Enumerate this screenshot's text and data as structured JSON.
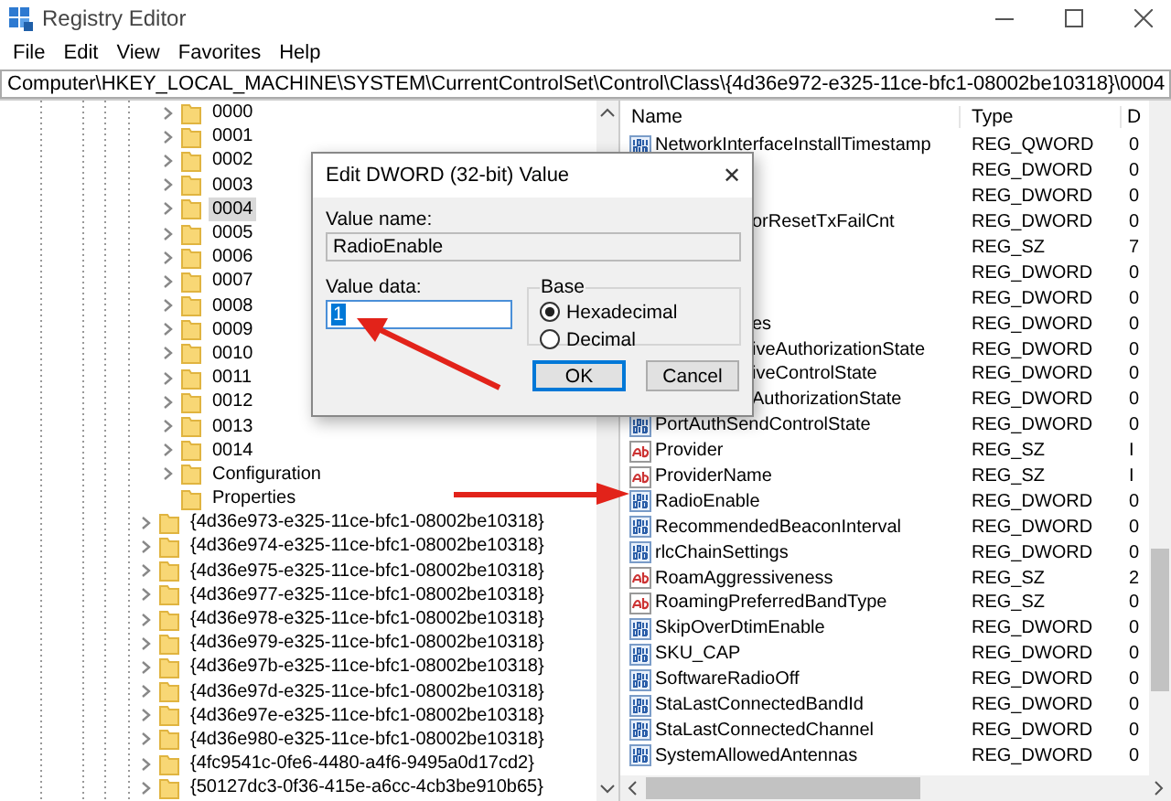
{
  "window": {
    "title": "Registry Editor"
  },
  "menu": [
    "File",
    "Edit",
    "View",
    "Favorites",
    "Help"
  ],
  "address": "Computer\\HKEY_LOCAL_MACHINE\\SYSTEM\\CurrentControlSet\\Control\\Class\\{4d36e972-e325-11ce-bfc1-08002be10318}\\0004",
  "tree": {
    "nodes": [
      {
        "children": [
          {
            "label": "0000",
            "expandable": true,
            "selected": false
          },
          {
            "label": "0001",
            "expandable": true,
            "selected": false
          },
          {
            "label": "0002",
            "expandable": true,
            "selected": false
          },
          {
            "label": "0003",
            "expandable": true,
            "selected": false
          },
          {
            "label": "0004",
            "expandable": true,
            "selected": true
          },
          {
            "label": "0005",
            "expandable": true,
            "selected": false
          },
          {
            "label": "0006",
            "expandable": true,
            "selected": false
          },
          {
            "label": "0007",
            "expandable": true,
            "selected": false
          },
          {
            "label": "0008",
            "expandable": true,
            "selected": false
          },
          {
            "label": "0009",
            "expandable": true,
            "selected": false
          },
          {
            "label": "0010",
            "expandable": true,
            "selected": false
          },
          {
            "label": "0011",
            "expandable": true,
            "selected": false
          },
          {
            "label": "0012",
            "expandable": true,
            "selected": false
          },
          {
            "label": "0013",
            "expandable": true,
            "selected": false
          },
          {
            "label": "0014",
            "expandable": true,
            "selected": false
          },
          {
            "label": "Configuration",
            "expandable": true,
            "selected": false
          },
          {
            "label": "Properties",
            "expandable": false,
            "selected": false
          }
        ]
      },
      {
        "label": "{4d36e973-e325-11ce-bfc1-08002be10318}",
        "expandable": true,
        "selected": false
      },
      {
        "label": "{4d36e974-e325-11ce-bfc1-08002be10318}",
        "expandable": true,
        "selected": false
      },
      {
        "label": "{4d36e975-e325-11ce-bfc1-08002be10318}",
        "expandable": true,
        "selected": false
      },
      {
        "label": "{4d36e977-e325-11ce-bfc1-08002be10318}",
        "expandable": true,
        "selected": false
      },
      {
        "label": "{4d36e978-e325-11ce-bfc1-08002be10318}",
        "expandable": true,
        "selected": false
      },
      {
        "label": "{4d36e979-e325-11ce-bfc1-08002be10318}",
        "expandable": true,
        "selected": false
      },
      {
        "label": "{4d36e97b-e325-11ce-bfc1-08002be10318}",
        "expandable": true,
        "selected": false
      },
      {
        "label": "{4d36e97d-e325-11ce-bfc1-08002be10318}",
        "expandable": true,
        "selected": false
      },
      {
        "label": "{4d36e97e-e325-11ce-bfc1-08002be10318}",
        "expandable": true,
        "selected": false
      },
      {
        "label": "{4d36e980-e325-11ce-bfc1-08002be10318}",
        "expandable": true,
        "selected": false
      },
      {
        "label": "{4fc9541c-0fe6-4480-a4f6-9495a0d17cd2}",
        "expandable": true,
        "selected": false
      },
      {
        "label": "{50127dc3-0f36-415e-a6cc-4cb3be910b65}",
        "expandable": true,
        "selected": false
      }
    ]
  },
  "values": {
    "columns": [
      "Name",
      "Type",
      "D"
    ],
    "rows": [
      {
        "name": "NetworkInterfaceInstallTimestamp",
        "type": "REG_QWORD",
        "data": "0",
        "kind": "number",
        "covered": false
      },
      {
        "type": "REG_DWORD",
        "data": "0"
      },
      {
        "type": "REG_DWORD",
        "data": "0"
      },
      {
        "name": "orResetTxFailCnt",
        "type": "REG_DWORD",
        "data": "0",
        "covered": true
      },
      {
        "type": "REG_SZ",
        "data": "7"
      },
      {
        "type": "REG_DWORD",
        "data": "0"
      },
      {
        "type": "REG_DWORD",
        "data": "0"
      },
      {
        "name": "es",
        "type": "REG_DWORD",
        "data": "0",
        "covered": true
      },
      {
        "name": "iveAuthorizationState",
        "type": "REG_DWORD",
        "data": "0",
        "covered": true
      },
      {
        "name": "iveControlState",
        "type": "REG_DWORD",
        "data": "0",
        "covered": true
      },
      {
        "name": "AuthorizationState",
        "type": "REG_DWORD",
        "data": "0",
        "covered": true
      },
      {
        "name": "PortAuthSendControlState",
        "type": "REG_DWORD",
        "data": "0",
        "kind": "number",
        "covered": false
      },
      {
        "name": "Provider",
        "type": "REG_SZ",
        "data": "I",
        "kind": "string",
        "covered": false
      },
      {
        "name": "ProviderName",
        "type": "REG_SZ",
        "data": "I",
        "kind": "string",
        "covered": false
      },
      {
        "name": "RadioEnable",
        "type": "REG_DWORD",
        "data": "0",
        "kind": "number",
        "covered": false
      },
      {
        "name": "RecommendedBeaconInterval",
        "type": "REG_DWORD",
        "data": "0",
        "kind": "number",
        "covered": false
      },
      {
        "name": "rlcChainSettings",
        "type": "REG_DWORD",
        "data": "0",
        "kind": "number",
        "covered": false
      },
      {
        "name": "RoamAggressiveness",
        "type": "REG_SZ",
        "data": "2",
        "kind": "string",
        "covered": false
      },
      {
        "name": "RoamingPreferredBandType",
        "type": "REG_SZ",
        "data": "0",
        "kind": "string",
        "covered": false
      },
      {
        "name": "SkipOverDtimEnable",
        "type": "REG_DWORD",
        "data": "0",
        "kind": "number",
        "covered": false
      },
      {
        "name": "SKU_CAP",
        "type": "REG_DWORD",
        "data": "0",
        "kind": "number",
        "covered": false
      },
      {
        "name": "SoftwareRadioOff",
        "type": "REG_DWORD",
        "data": "0",
        "kind": "number",
        "covered": false
      },
      {
        "name": "StaLastConnectedBandId",
        "type": "REG_DWORD",
        "data": "0",
        "kind": "number",
        "covered": false
      },
      {
        "name": "StaLastConnectedChannel",
        "type": "REG_DWORD",
        "data": "0",
        "kind": "number",
        "covered": false
      },
      {
        "name": "SystemAllowedAntennas",
        "type": "REG_DWORD",
        "data": "0",
        "kind": "number",
        "covered": false
      }
    ]
  },
  "dialog": {
    "title": "Edit DWORD (32-bit) Value",
    "close": "✕",
    "value_name_label": "Value name:",
    "value_name": "RadioEnable",
    "value_data_label": "Value data:",
    "value_data": "1",
    "base_label": "Base",
    "base_options": [
      {
        "label": "Hexadecimal",
        "selected": true
      },
      {
        "label": "Decimal",
        "selected": false
      }
    ],
    "buttons": [
      {
        "label": "OK",
        "default": true
      },
      {
        "label": "Cancel",
        "default": false
      }
    ]
  }
}
